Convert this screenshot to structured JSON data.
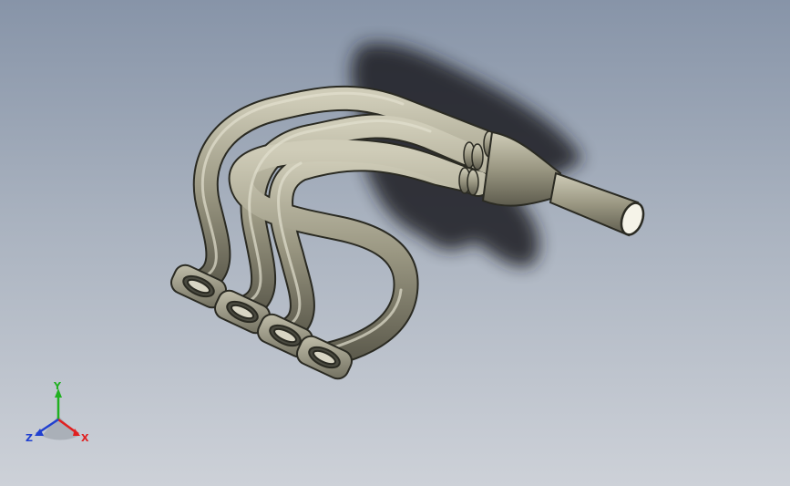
{
  "view": {
    "background_top": "#8794a8",
    "background_bottom": "#cdd1d8"
  },
  "model": {
    "name": "exhaust-header",
    "pipe_color": "#9a9782",
    "pipe_edge_color": "#2a2a22",
    "shadow_color": "#1c1e22",
    "runner_count": 4
  },
  "triad": {
    "x_label": "X",
    "y_label": "Y",
    "z_label": "Z",
    "x_color": "#e02020",
    "y_color": "#20b020",
    "z_color": "#2040d0"
  }
}
